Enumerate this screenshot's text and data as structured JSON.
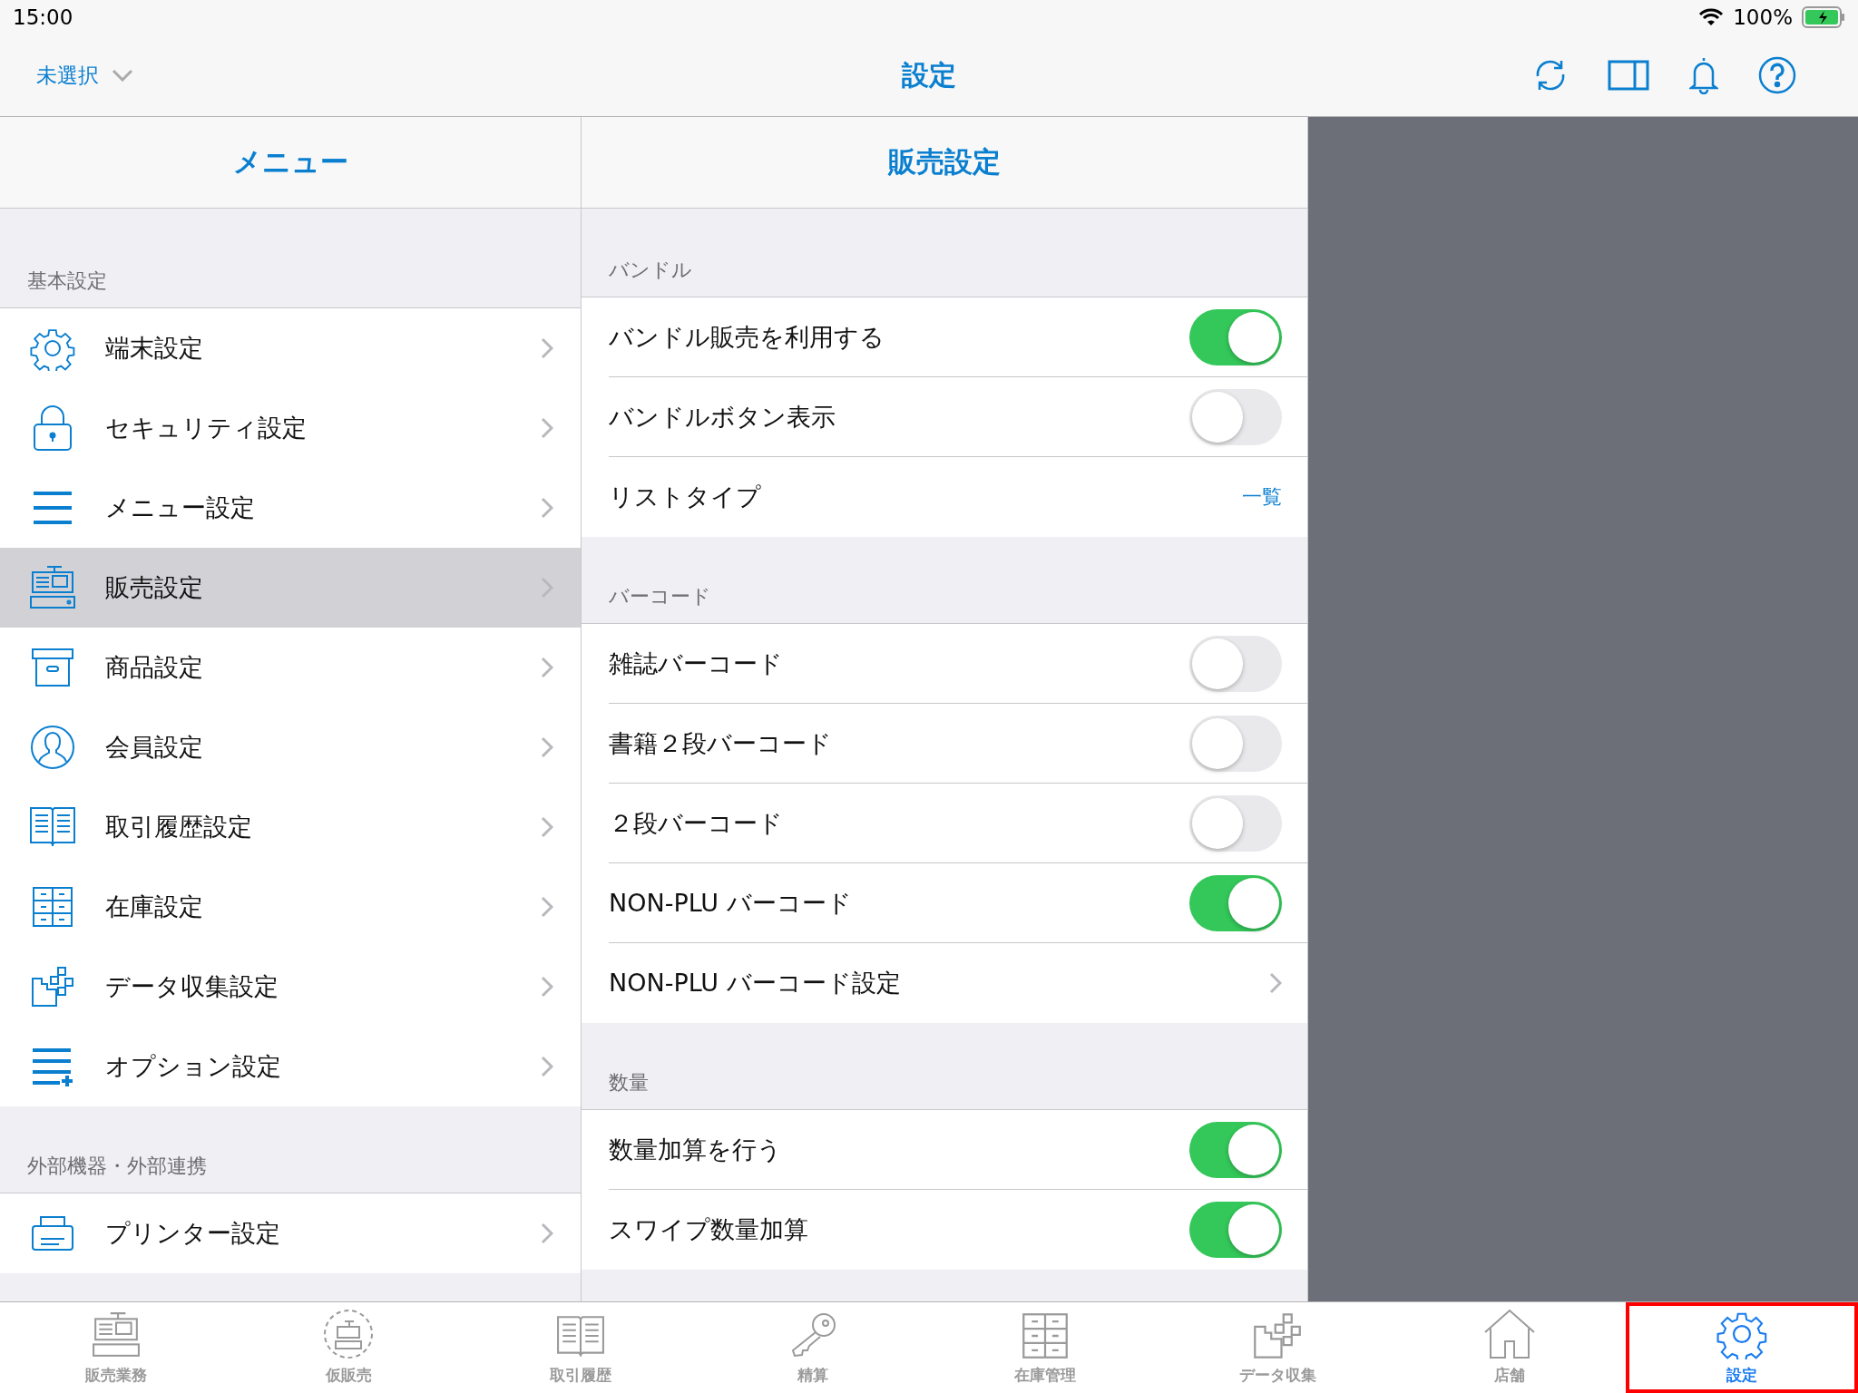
{
  "status_bar": {
    "time": "15:00",
    "battery": "100%"
  },
  "nav_bar": {
    "store_picker": "未選択",
    "title": "設定"
  },
  "menu": {
    "title": "メニュー",
    "sections": [
      {
        "header": "基本設定",
        "items": [
          {
            "label": "端末設定",
            "selected": false
          },
          {
            "label": "セキュリティ設定",
            "selected": false
          },
          {
            "label": "メニュー設定",
            "selected": false
          },
          {
            "label": "販売設定",
            "selected": true
          },
          {
            "label": "商品設定",
            "selected": false
          },
          {
            "label": "会員設定",
            "selected": false
          },
          {
            "label": "取引履歴設定",
            "selected": false
          },
          {
            "label": "在庫設定",
            "selected": false
          },
          {
            "label": "データ収集設定",
            "selected": false
          },
          {
            "label": "オプション設定",
            "selected": false
          }
        ]
      },
      {
        "header": "外部機器・外部連携",
        "items": [
          {
            "label": "プリンター設定",
            "selected": false
          }
        ]
      }
    ]
  },
  "detail": {
    "title": "販売設定",
    "sections": [
      {
        "header": "バンドル",
        "rows": [
          {
            "kind": "toggle",
            "label": "バンドル販売を利用する",
            "on": true
          },
          {
            "kind": "toggle",
            "label": "バンドルボタン表示",
            "on": false
          },
          {
            "kind": "value",
            "label": "リストタイプ",
            "value": "一覧"
          }
        ]
      },
      {
        "header": "バーコード",
        "rows": [
          {
            "kind": "toggle",
            "label": "雑誌バーコード",
            "on": false
          },
          {
            "kind": "toggle",
            "label": "書籍２段バーコード",
            "on": false
          },
          {
            "kind": "toggle",
            "label": "２段バーコード",
            "on": false
          },
          {
            "kind": "toggle",
            "label": "NON-PLU バーコード",
            "on": true
          },
          {
            "kind": "link",
            "label": "NON-PLU バーコード設定"
          }
        ]
      },
      {
        "header": "数量",
        "rows": [
          {
            "kind": "toggle",
            "label": "数量加算を行う",
            "on": true
          },
          {
            "kind": "toggle",
            "label": "スワイプ数量加算",
            "on": true
          }
        ]
      }
    ]
  },
  "tab_bar": [
    {
      "label": "販売業務",
      "selected": false,
      "highlighted": false
    },
    {
      "label": "仮販売",
      "selected": false,
      "highlighted": false
    },
    {
      "label": "取引履歴",
      "selected": false,
      "highlighted": false
    },
    {
      "label": "精算",
      "selected": false,
      "highlighted": false
    },
    {
      "label": "在庫管理",
      "selected": false,
      "highlighted": false
    },
    {
      "label": "データ収集",
      "selected": false,
      "highlighted": false
    },
    {
      "label": "店舗",
      "selected": false,
      "highlighted": false
    },
    {
      "label": "設定",
      "selected": true,
      "highlighted": true
    }
  ]
}
